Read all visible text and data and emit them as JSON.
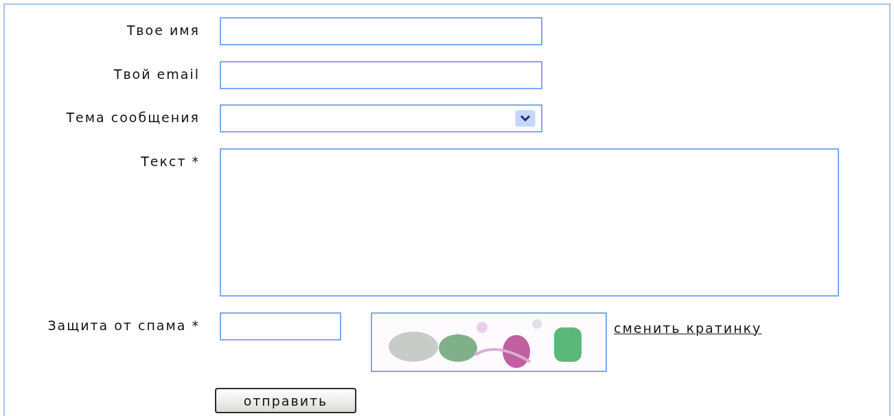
{
  "fields": [
    {
      "label": "Твое имя",
      "kind": "text"
    },
    {
      "label": "Твой email",
      "kind": "text"
    },
    {
      "label": "Тема сообщения",
      "kind": "select"
    },
    {
      "label": "Текст *",
      "kind": "textarea"
    }
  ],
  "captcha": {
    "label": "Защита от спама *",
    "refresh_link": "сменить кратинку"
  },
  "submit": "отправить"
}
